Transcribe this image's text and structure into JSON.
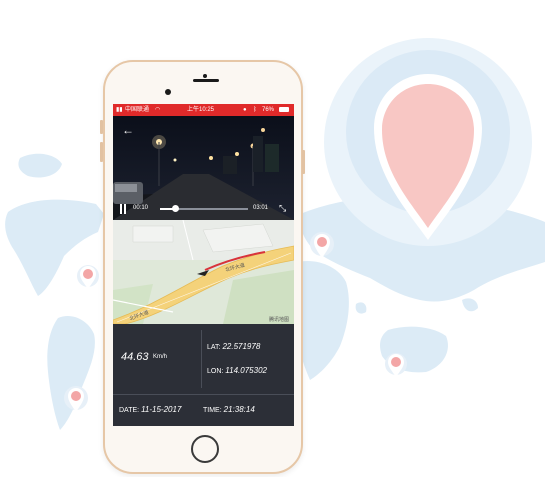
{
  "colors": {
    "accent_red": "#e02a2a",
    "pin_pink": "#f8c7c4",
    "pin_ring": "#dbeaf6",
    "map_blue": "#dcebf6",
    "road_yellow": "#f4d27a",
    "track_red": "#d8333a",
    "info_bg": "#2c2f37"
  },
  "status_bar": {
    "carrier": "中国联通",
    "time": "上午10:25",
    "battery": "76%"
  },
  "video": {
    "back_icon": "back-arrow-icon",
    "current_time": "00:10",
    "total_time": "03:01",
    "progress": 0.17,
    "fullscreen_icon": "fullscreen-icon",
    "pause_icon": "pause-icon"
  },
  "map": {
    "road_label_1": "北环大道",
    "road_label_2": "北环大道",
    "watermark": "腾讯地图"
  },
  "info": {
    "speed": "44.63",
    "speed_unit": "Km/h",
    "lat_label": "LAT:",
    "lat_value": "22.571978",
    "lon_label": "LON:",
    "lon_value": "114.075302",
    "date_label": "DATE:",
    "date_value": "11-15-2017",
    "time_label": "TIME:",
    "time_value": "21:38:14"
  }
}
